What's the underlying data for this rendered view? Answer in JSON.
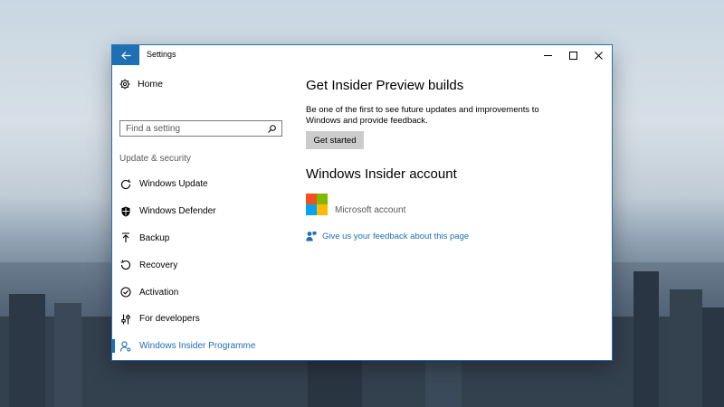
{
  "window": {
    "title": "Settings",
    "accent": "#1f6fb4"
  },
  "sidebar": {
    "home_label": "Home",
    "search_placeholder": "Find a setting",
    "section_label": "Update & security",
    "items": [
      {
        "label": "Windows Update",
        "icon": "refresh-icon"
      },
      {
        "label": "Windows Defender",
        "icon": "shield-icon"
      },
      {
        "label": "Backup",
        "icon": "backup-arrow-icon"
      },
      {
        "label": "Recovery",
        "icon": "recovery-icon"
      },
      {
        "label": "Activation",
        "icon": "activation-check-icon"
      },
      {
        "label": "For developers",
        "icon": "developer-sliders-icon"
      },
      {
        "label": "Windows Insider Programme",
        "icon": "insider-person-icon",
        "active": true
      }
    ]
  },
  "main": {
    "insider_heading": "Get Insider Preview builds",
    "insider_description": "Be one of the first to see future updates and improvements to Windows and provide feedback.",
    "get_started_label": "Get started",
    "account_heading": "Windows Insider account",
    "account_label": "Microsoft account",
    "feedback_link": "Give us your feedback about this page"
  },
  "ms_logo_colors": [
    "#f25022",
    "#7fba00",
    "#00a4ef",
    "#ffb900"
  ]
}
